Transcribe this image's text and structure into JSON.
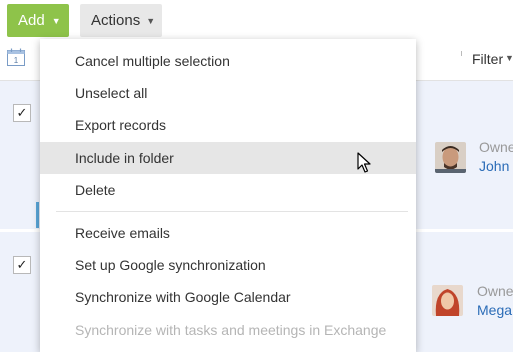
{
  "toolbar": {
    "add_label": "Add",
    "actions_label": "Actions"
  },
  "filterbar": {
    "filter_label": "Filter",
    "calendar_day": "1"
  },
  "menu": {
    "items": [
      {
        "label": "Cancel multiple selection",
        "state": "normal"
      },
      {
        "label": "Unselect all",
        "state": "normal"
      },
      {
        "label": "Export records",
        "state": "normal"
      },
      {
        "label": "Include in folder",
        "state": "hover"
      },
      {
        "label": "Delete",
        "state": "normal"
      },
      {
        "label": "Receive emails",
        "state": "normal"
      },
      {
        "label": "Set up Google synchronization",
        "state": "normal"
      },
      {
        "label": "Synchronize with Google Calendar",
        "state": "normal"
      },
      {
        "label": "Synchronize with tasks and meetings in Exchange",
        "state": "disabled"
      }
    ]
  },
  "records": [
    {
      "checked": "✓",
      "owner_label": "Owne",
      "owner_name": "John"
    },
    {
      "checked": "✓",
      "owner_label": "Owne",
      "owner_name": "Mega"
    }
  ],
  "colors": {
    "add": "#8ec34a",
    "row_selected": "#eef2fb",
    "link": "#2b6cb7",
    "hover": "#e6e6e6"
  }
}
